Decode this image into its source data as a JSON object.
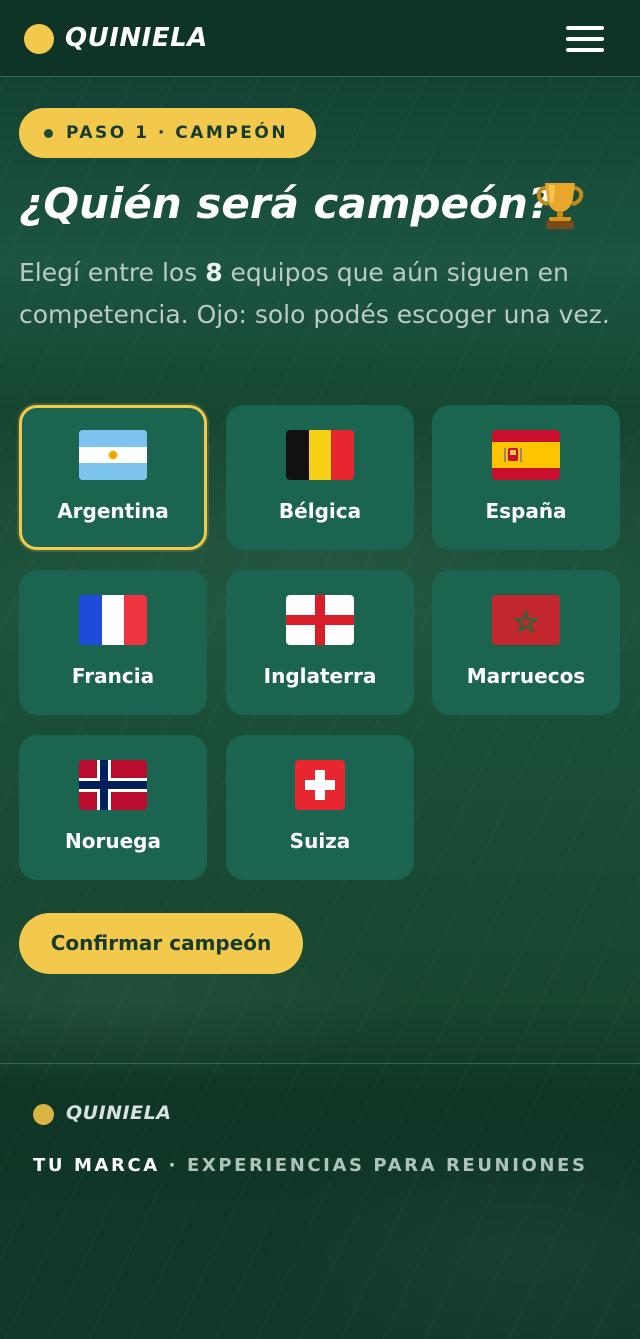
{
  "header": {
    "logo_text": "QUINIELA",
    "menu_icon": "hamburger-menu-icon"
  },
  "step": {
    "label": "PASO 1 · CAMPEÓN"
  },
  "title": {
    "text": "¿Quién será campeón?",
    "icon": "trophy-icon"
  },
  "description": {
    "before": "Elegí entre los ",
    "count": "8",
    "after": " equipos que aún siguen en competencia. Ojo: solo podés escoger una vez."
  },
  "teams": [
    {
      "name": "Argentina",
      "flag_icon": "argentina-flag-icon",
      "selected": true
    },
    {
      "name": "Bélgica",
      "flag_icon": "belgium-flag-icon",
      "selected": false
    },
    {
      "name": "España",
      "flag_icon": "spain-flag-icon",
      "selected": false
    },
    {
      "name": "Francia",
      "flag_icon": "france-flag-icon",
      "selected": false
    },
    {
      "name": "Inglaterra",
      "flag_icon": "england-flag-icon",
      "selected": false
    },
    {
      "name": "Marruecos",
      "flag_icon": "morocco-flag-icon",
      "selected": false
    },
    {
      "name": "Noruega",
      "flag_icon": "norway-flag-icon",
      "selected": false
    },
    {
      "name": "Suiza",
      "flag_icon": "switzerland-flag-icon",
      "selected": false
    }
  ],
  "confirm_button": {
    "label": "Confirmar campeón"
  },
  "footer": {
    "logo_text": "QUINIELA",
    "brand": "TU MARCA",
    "separator": " · ",
    "tagline": "EXPERIENCIAS PARA REUNIONES"
  },
  "colors": {
    "accent": "#f2c94c",
    "card": "#1b6450",
    "header_bg": "#0e3327",
    "text_muted": "#b9cbc3"
  }
}
